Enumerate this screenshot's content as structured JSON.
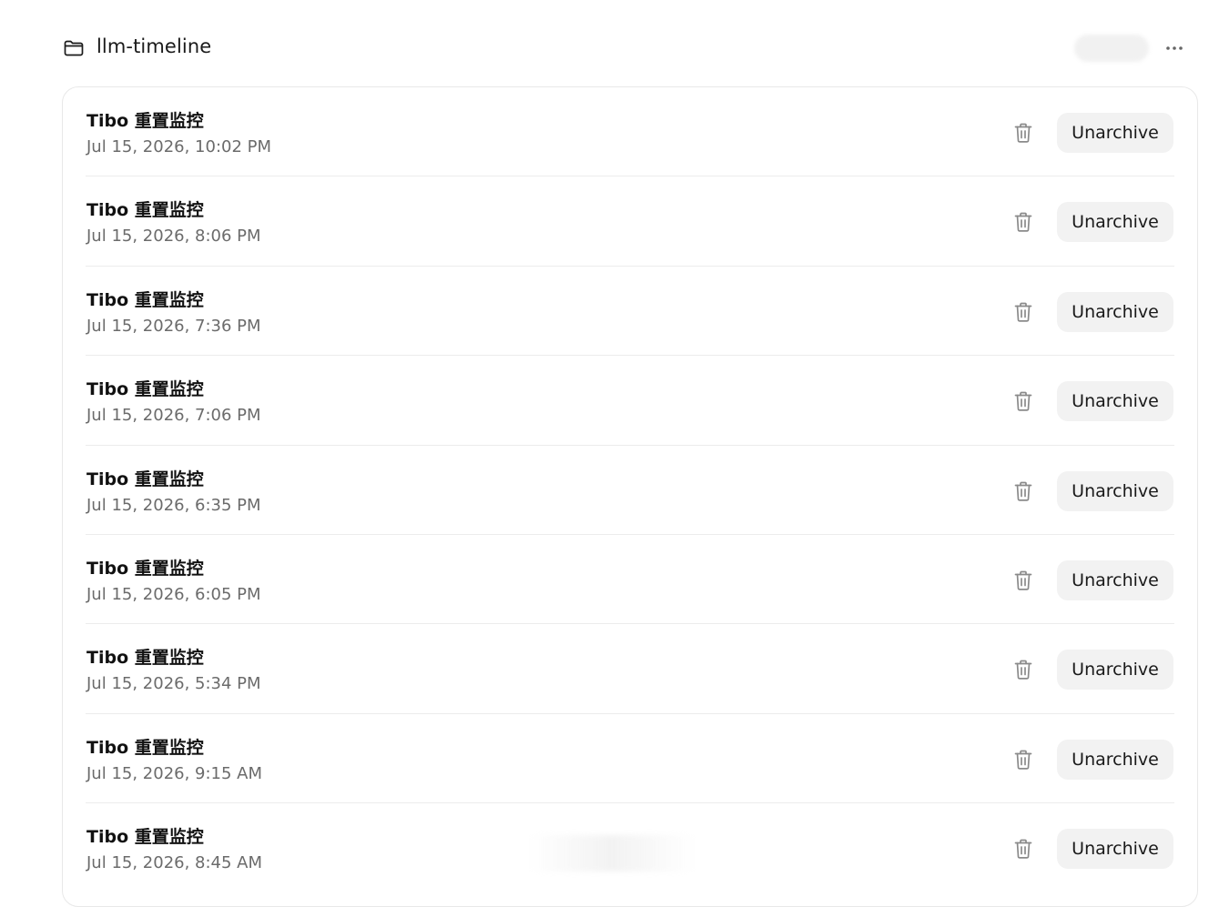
{
  "header": {
    "project_title": "llm-timeline",
    "folder_icon": "folder-icon",
    "more_icon": "more-horizontal-icon"
  },
  "rows": [
    {
      "title": "Tibo 重置监控",
      "date": "Jul 15, 2026, 10:02 PM",
      "action_label": "Unarchive"
    },
    {
      "title": "Tibo 重置监控",
      "date": "Jul 15, 2026, 8:06 PM",
      "action_label": "Unarchive"
    },
    {
      "title": "Tibo 重置监控",
      "date": "Jul 15, 2026, 7:36 PM",
      "action_label": "Unarchive"
    },
    {
      "title": "Tibo 重置监控",
      "date": "Jul 15, 2026, 7:06 PM",
      "action_label": "Unarchive"
    },
    {
      "title": "Tibo 重置监控",
      "date": "Jul 15, 2026, 6:35 PM",
      "action_label": "Unarchive"
    },
    {
      "title": "Tibo 重置监控",
      "date": "Jul 15, 2026, 6:05 PM",
      "action_label": "Unarchive"
    },
    {
      "title": "Tibo 重置监控",
      "date": "Jul 15, 2026, 5:34 PM",
      "action_label": "Unarchive"
    },
    {
      "title": "Tibo 重置监控",
      "date": "Jul 15, 2026, 9:15 AM",
      "action_label": "Unarchive"
    },
    {
      "title": "Tibo 重置监控",
      "date": "Jul 15, 2026, 8:45 AM",
      "action_label": "Unarchive"
    }
  ],
  "icons": {
    "delete": "trash-icon"
  },
  "colors": {
    "background": "#ffffff",
    "button_bg": "#f2f2f2",
    "divider": "#ececec",
    "muted_text": "#6b6b6b",
    "icon": "#8a8a8a"
  }
}
